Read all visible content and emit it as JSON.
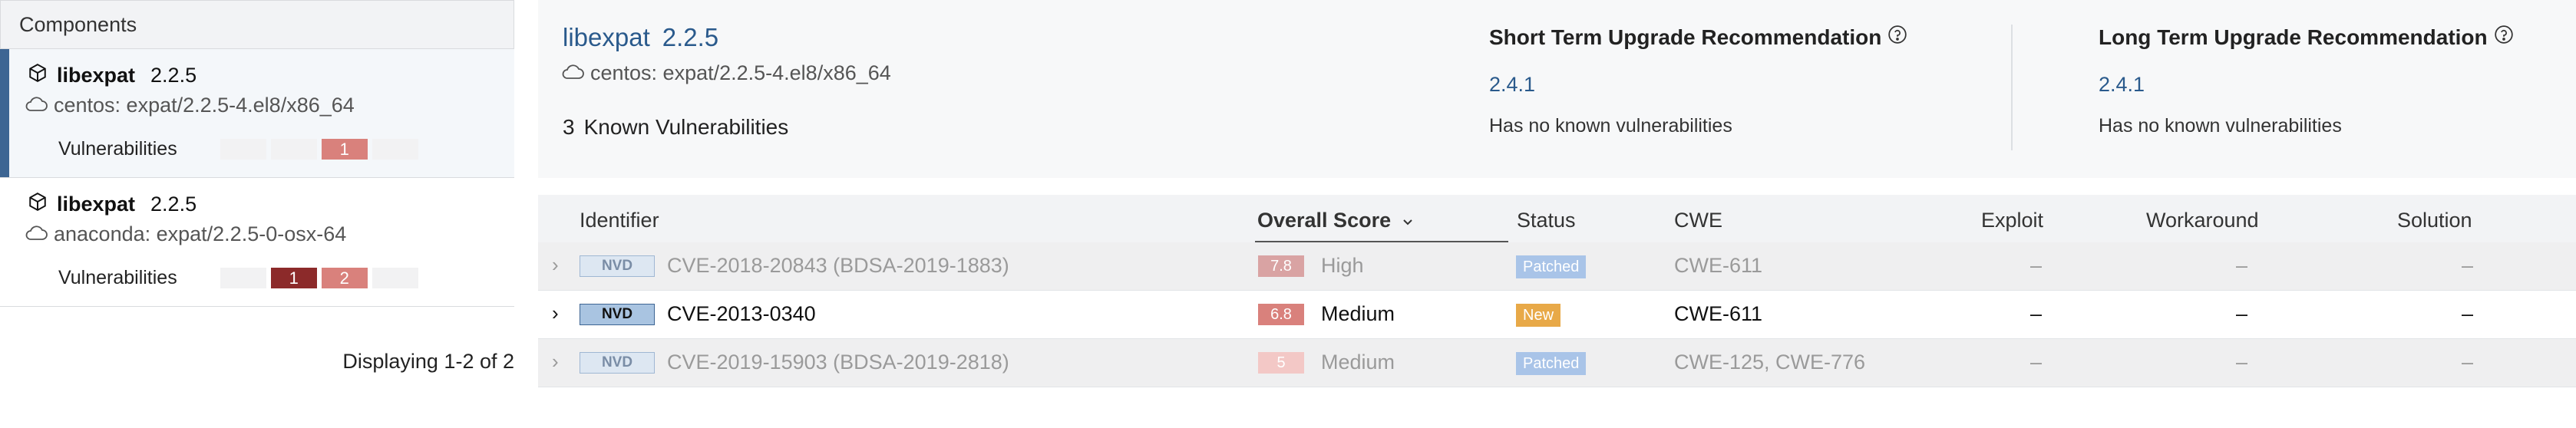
{
  "left": {
    "header": "Components",
    "components": [
      {
        "name": "libexpat",
        "version": "2.2.5",
        "origin": "centos: expat/2.2.5-4.el8/x86_64",
        "vuln_label": "Vulnerabilities",
        "counts": [
          "",
          "",
          "1",
          ""
        ],
        "selected": true
      },
      {
        "name": "libexpat",
        "version": "2.2.5",
        "origin": "anaconda: expat/2.2.5-0-osx-64",
        "vuln_label": "Vulnerabilities",
        "counts": [
          "",
          "1",
          "2",
          ""
        ],
        "selected": false
      }
    ],
    "count_colors": [
      "#f2f2f3",
      "#8c2a2a",
      "#d9817c",
      "#f2f2f3"
    ],
    "displaying": "Displaying 1-2 of 2"
  },
  "summary": {
    "name": "libexpat",
    "version": "2.2.5",
    "origin": "centos: expat/2.2.5-4.el8/x86_64",
    "known_count": "3",
    "known_label": "Known Vulnerabilities",
    "short_term": {
      "title": "Short Term Upgrade Recommendation",
      "version": "2.4.1",
      "note": "Has no known vulnerabilities"
    },
    "long_term": {
      "title": "Long Term Upgrade Recommendation",
      "version": "2.4.1",
      "note": "Has no known vulnerabilities"
    }
  },
  "table": {
    "headers": {
      "identifier": "Identifier",
      "score": "Overall Score",
      "status": "Status",
      "cwe": "CWE",
      "exploit": "Exploit",
      "workaround": "Workaround",
      "solution": "Solution"
    },
    "rows": [
      {
        "source": "NVD",
        "id": "CVE-2018-20843 (BDSA-2019-1883)",
        "score": "7.8",
        "severity": "High",
        "score_color": "#d9a3a3",
        "status": "Patched",
        "status_color": "#a9c4e8",
        "cwe": "CWE-611",
        "exploit": "–",
        "workaround": "–",
        "solution": "–",
        "active": false
      },
      {
        "source": "NVD",
        "id": "CVE-2013-0340",
        "score": "6.8",
        "severity": "Medium",
        "score_color": "#d9817c",
        "status": "New",
        "status_color": "#e8a948",
        "cwe": "CWE-611",
        "exploit": "–",
        "workaround": "–",
        "solution": "–",
        "active": true
      },
      {
        "source": "NVD",
        "id": "CVE-2019-15903 (BDSA-2019-2818)",
        "score": "5",
        "severity": "Medium",
        "score_color": "#f3c8c6",
        "status": "Patched",
        "status_color": "#a9c4e8",
        "cwe": "CWE-125, CWE-776",
        "exploit": "–",
        "workaround": "–",
        "solution": "–",
        "active": false
      }
    ]
  }
}
